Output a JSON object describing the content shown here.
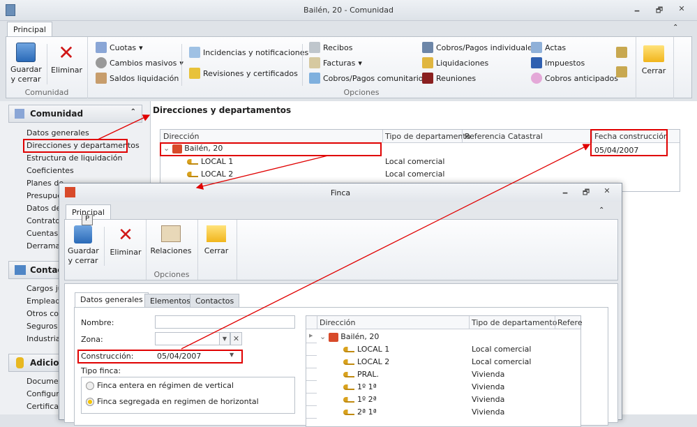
{
  "window": {
    "title": "Bailén, 20 - Comunidad",
    "minimize": "🗕",
    "restore": "🗗",
    "close": "✕",
    "collapse": "⌃"
  },
  "ribbon": {
    "tab": "Principal",
    "guardar": "Guardar y cerrar",
    "eliminar": "Eliminar",
    "group_comunidad": "Comunidad",
    "cuotas": "Cuotas",
    "cambios": "Cambios masivos",
    "saldos": "Saldos liquidación",
    "incidencias": "Incidencias y notificaciones",
    "revisiones": "Revisiones y certificados",
    "recibos": "Recibos",
    "facturas": "Facturas",
    "cobros_com": "Cobros/Pagos comunitarios",
    "cobros_ind": "Cobros/Pagos individuales",
    "liquidaciones": "Liquidaciones",
    "reuniones": "Reuniones",
    "actas": "Actas",
    "impuestos": "Impuestos",
    "cobros_ant": "Cobros anticipados",
    "group_opciones": "Opciones",
    "cerrar": "Cerrar"
  },
  "sidebar": {
    "comunidad": {
      "title": "Comunidad",
      "items": [
        "Datos generales",
        "Direcciones y departamentos",
        "Estructura de liquidación",
        "Coeficientes",
        "Planes de",
        "Presupue",
        "Datos de",
        "Contratos",
        "Cuentas b",
        "Derramas"
      ]
    },
    "contactos": {
      "title": "Contact",
      "items": [
        "Cargos ju",
        "Empleado",
        "Otros con",
        "Seguros y",
        "Industrial"
      ]
    },
    "adicional": {
      "title": "Adiciona",
      "items": [
        "Document",
        "Configura",
        "Certificad"
      ]
    }
  },
  "main": {
    "title": "Direcciones y departamentos",
    "columns": [
      "Dirección",
      "Tipo de departamento",
      "Referencia Catastral",
      "Fecha construcción"
    ],
    "rows": [
      {
        "dir": "Bailén, 20",
        "tipo": "",
        "fecha": "05/04/2007"
      },
      {
        "dir": "LOCAL 1",
        "tipo": "Local comercial"
      },
      {
        "dir": "LOCAL 2",
        "tipo": "Local comercial"
      }
    ]
  },
  "dialog": {
    "title": "Finca",
    "tab": "Principal",
    "keytip": "P",
    "guardar": "Guardar y cerrar",
    "eliminar": "Eliminar",
    "relaciones": "Relaciones",
    "cerrar": "Cerrar",
    "group_opciones": "Opciones",
    "tabs": [
      "Datos generales",
      "Elementos",
      "Contactos"
    ],
    "form": {
      "nombre_label": "Nombre:",
      "nombre": "",
      "zona_label": "Zona:",
      "zona": "",
      "construccion_label": "Construcción:",
      "construccion": "05/04/2007",
      "tipo_label": "Tipo finca:",
      "radios": [
        {
          "label": "Finca entera en régimen de vertical",
          "checked": false
        },
        {
          "label": "Finca segregada en regimen de horizontal",
          "checked": true
        }
      ]
    },
    "grid": {
      "columns": [
        "Dirección",
        "Tipo de departamento",
        "Refere"
      ],
      "rows": [
        {
          "dir": "Bailén, 20",
          "tipo": ""
        },
        {
          "dir": "LOCAL 1",
          "tipo": "Local comercial"
        },
        {
          "dir": "LOCAL 2",
          "tipo": "Local comercial"
        },
        {
          "dir": "PRAL.",
          "tipo": "Vivienda"
        },
        {
          "dir": "1º 1ª",
          "tipo": "Vivienda"
        },
        {
          "dir": "1º 2ª",
          "tipo": "Vivienda"
        },
        {
          "dir": "2ª 1ª",
          "tipo": "Vivienda"
        }
      ]
    }
  },
  "colors": {
    "highlight": "#e00000",
    "accent": "#2a6ab8"
  }
}
